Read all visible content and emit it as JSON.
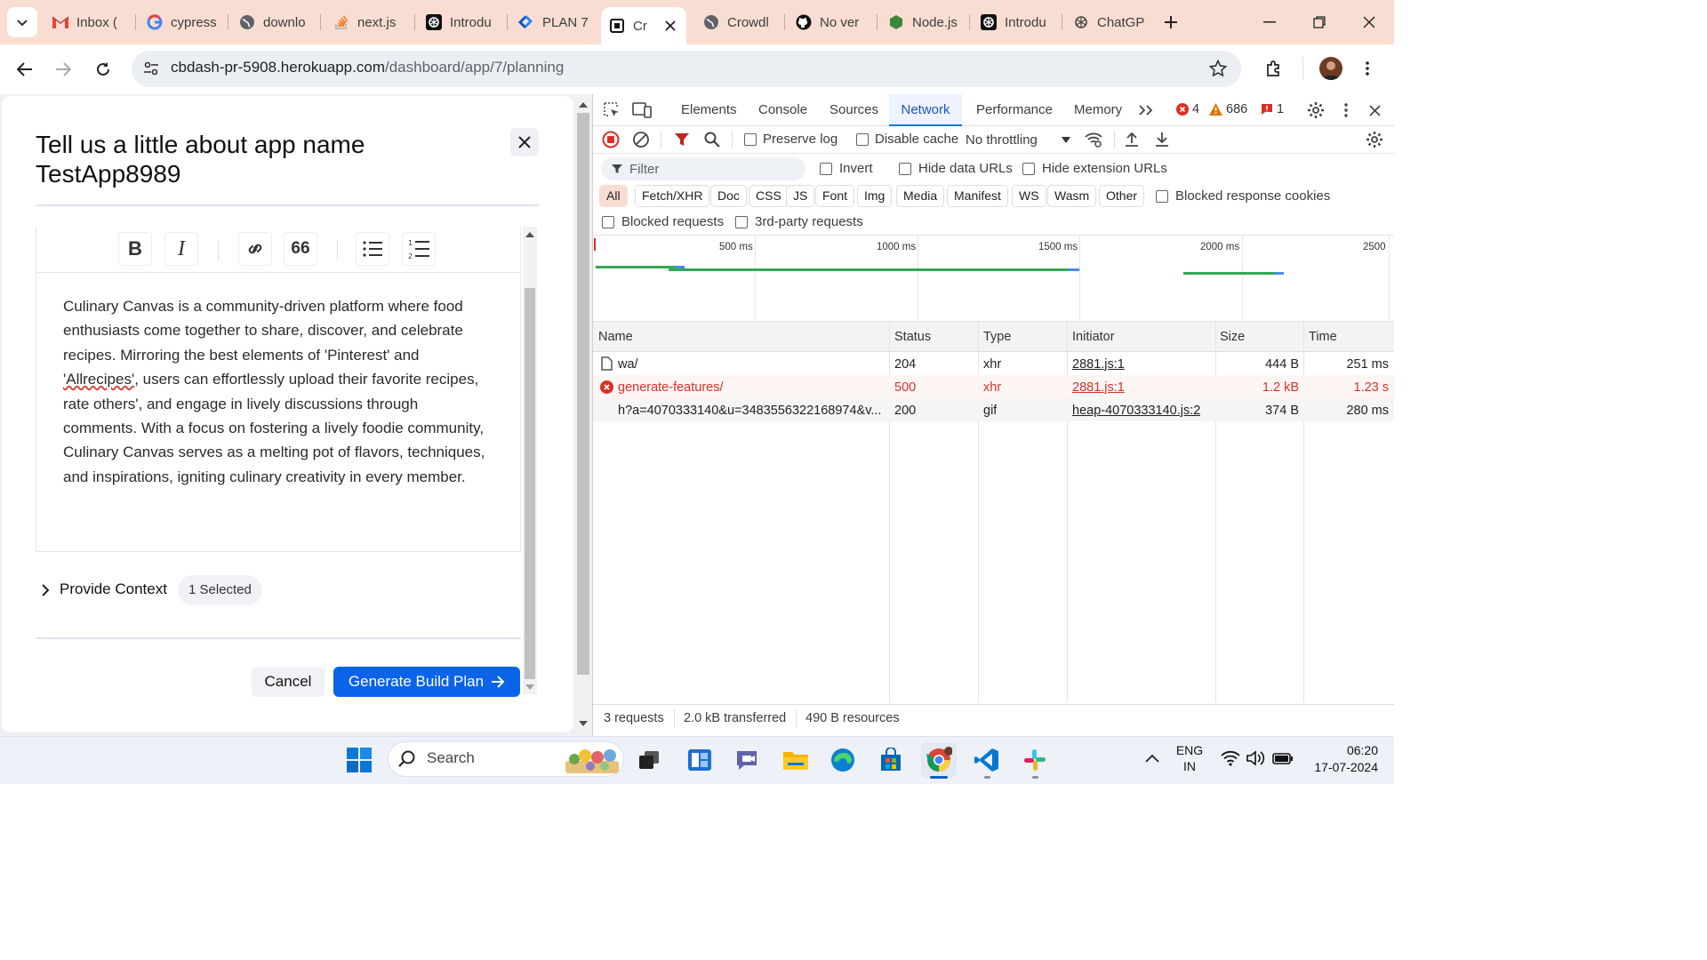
{
  "browser": {
    "tabs": [
      {
        "title": "Inbox (",
        "icon": "gmail-icon"
      },
      {
        "title": "cypress",
        "icon": "google-icon"
      },
      {
        "title": "downlo",
        "icon": "globe-icon"
      },
      {
        "title": "next.js",
        "icon": "stackoverflow-icon"
      },
      {
        "title": "Introdu",
        "icon": "openai-icon"
      },
      {
        "title": "PLAN 7",
        "icon": "jira-icon"
      },
      {
        "title": "Cr",
        "icon": "cb-icon"
      },
      {
        "title": "Crowdl",
        "icon": "globe-icon"
      },
      {
        "title": "No ver",
        "icon": "github-icon"
      },
      {
        "title": "Node.js",
        "icon": "nodejs-icon"
      },
      {
        "title": "Introdu",
        "icon": "openai-icon"
      },
      {
        "title": "ChatGP",
        "icon": "openai-icon"
      }
    ],
    "url_host": "cbdash-pr-5908.herokuapp.com",
    "url_path": "/dashboard/app/7/planning"
  },
  "modal": {
    "title": "Tell us a little about app name TestApp8989",
    "body_before": "Culinary Canvas is a community-driven platform where food enthusiasts come together to share, discover, and celebrate recipes. Mirroring the best elements of 'Pinterest' and ",
    "body_misspelled": "'Allrecipes'",
    "body_after": ", users can effortlessly upload their favorite recipes, rate others', and engage in lively discussions through comments. With a focus on fostering a lively foodie community, Culinary Canvas serves as a melting pot of flavors, techniques, and inspirations, igniting culinary creativity in every member.",
    "context_label": "Provide Context",
    "context_badge": "1 Selected",
    "cancel_label": "Cancel",
    "generate_label": "Generate Build Plan",
    "accent": "#0a63e8"
  },
  "devtools": {
    "tabs": [
      "Elements",
      "Console",
      "Sources",
      "Network",
      "Performance",
      "Memory"
    ],
    "active_tab": "Network",
    "errors": "4",
    "warnings": "686",
    "issues": "1",
    "preserve_log": "Preserve log",
    "disable_cache": "Disable cache",
    "throttling": "No throttling",
    "filter_placeholder": "Filter",
    "invert": "Invert",
    "hide_data_urls": "Hide data URLs",
    "hide_ext_urls": "Hide extension URLs",
    "type_filters": [
      "All",
      "Fetch/XHR",
      "Doc",
      "CSS",
      "JS",
      "Font",
      "Img",
      "Media",
      "Manifest",
      "WS",
      "Wasm",
      "Other"
    ],
    "blocked_cookies": "Blocked response cookies",
    "blocked_requests": "Blocked requests",
    "third_party": "3rd-party requests",
    "timeline_ticks": [
      "500 ms",
      "1000 ms",
      "1500 ms",
      "2000 ms",
      "2500"
    ],
    "columns": [
      "Name",
      "Status",
      "Type",
      "Initiator",
      "Size",
      "Time"
    ],
    "rows": [
      {
        "name": "wa/",
        "status": "204",
        "type": "xhr",
        "initiator": "2881.js:1",
        "size": "444 B",
        "time": "251 ms",
        "error": false
      },
      {
        "name": "generate-features/",
        "status": "500",
        "type": "xhr",
        "initiator": "2881.js:1",
        "size": "1.2 kB",
        "time": "1.23 s",
        "error": true
      },
      {
        "name": "h?a=4070333140&u=3483556322168974&v...",
        "status": "200",
        "type": "gif",
        "initiator": "heap-4070333140.js:2",
        "size": "374 B",
        "time": "280 ms",
        "error": false
      }
    ],
    "status_requests": "3 requests",
    "status_transferred": "2.0 kB transferred",
    "status_resources": "490 B resources"
  },
  "taskbar": {
    "search_placeholder": "Search",
    "lang_1": "ENG",
    "lang_2": "IN",
    "time": "06:20",
    "date": "17-07-2024"
  }
}
